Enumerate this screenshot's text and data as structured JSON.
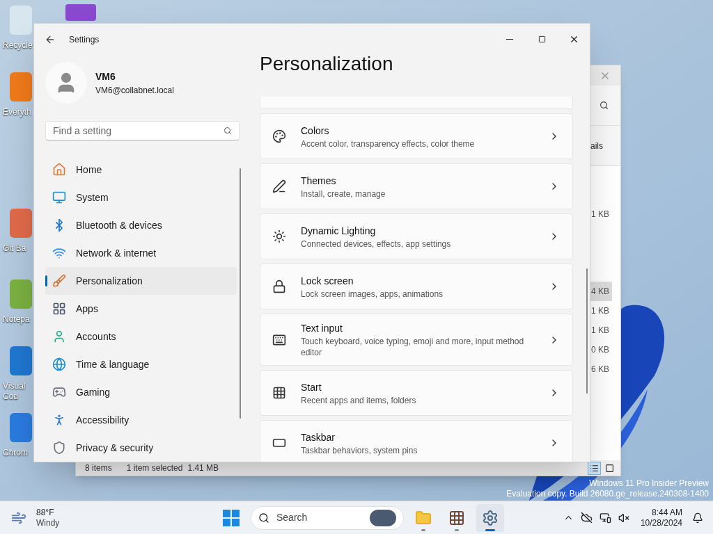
{
  "desktop_icons": [
    {
      "lines": [
        "Recycle"
      ]
    },
    {
      "lines": [
        "Everyth"
      ]
    },
    {
      "lines": [
        "Git Ba"
      ]
    },
    {
      "lines": [
        "Notepa"
      ]
    },
    {
      "lines": [
        "Visual",
        "Cod"
      ]
    },
    {
      "lines": [
        "Chrom"
      ]
    }
  ],
  "explorer": {
    "toolbar_text": "ails",
    "file_sizes": [
      {
        "text": "1 KB",
        "selected": false
      },
      {
        "text": "4 KB",
        "selected": true
      },
      {
        "text": "1 KB",
        "selected": false
      },
      {
        "text": "1 KB",
        "selected": false
      },
      {
        "text": "0 KB",
        "selected": false
      },
      {
        "text": "6 KB",
        "selected": false
      }
    ],
    "status_bar": {
      "item_count": "8 items",
      "selection": "1 item selected",
      "selection_size": "1.41 MB"
    },
    "views": [
      {
        "selected": true
      },
      {
        "selected": false
      }
    ]
  },
  "settings": {
    "window": {
      "title": "Settings"
    },
    "user": {
      "name": "VM6",
      "email": "VM6@collabnet.local"
    },
    "search": {
      "placeholder": "Find a setting"
    },
    "nav_items": [
      {
        "label": "Home",
        "selected": false
      },
      {
        "label": "System",
        "selected": false
      },
      {
        "label": "Bluetooth & devices",
        "selected": false
      },
      {
        "label": "Network & internet",
        "selected": false
      },
      {
        "label": "Personalization",
        "selected": true
      },
      {
        "label": "Apps",
        "selected": false
      },
      {
        "label": "Accounts",
        "selected": false
      },
      {
        "label": "Time & language",
        "selected": false
      },
      {
        "label": "Gaming",
        "selected": false
      },
      {
        "label": "Accessibility",
        "selected": false
      },
      {
        "label": "Privacy & security",
        "selected": false
      }
    ],
    "page_title": "Personalization",
    "cards": [
      {
        "title": "Colors",
        "description": "Accent color, transparency effects, color theme"
      },
      {
        "title": "Themes",
        "description": "Install, create, manage"
      },
      {
        "title": "Dynamic Lighting",
        "description": "Connected devices, effects, app settings"
      },
      {
        "title": "Lock screen",
        "description": "Lock screen images, apps, animations"
      },
      {
        "title": "Text input",
        "description": "Touch keyboard, voice typing, emoji and more, input method editor"
      },
      {
        "title": "Start",
        "description": "Recent apps and items, folders"
      },
      {
        "title": "Taskbar",
        "description": "Taskbar behaviors, system pins"
      }
    ]
  },
  "watermark": {
    "lines": [
      "Windows 11 Pro Insider Preview",
      "Evaluation copy. Build 26080.ge_release.240308-1400"
    ]
  },
  "taskbar": {
    "weather": {
      "temperature": "88°F",
      "condition": "Windy"
    },
    "search": {
      "placeholder": "Search"
    },
    "apps": [
      {
        "active": false
      },
      {
        "active": false
      },
      {
        "active": true
      }
    ],
    "clock": {
      "time": "8:44 AM",
      "date": "10/28/2024"
    }
  }
}
